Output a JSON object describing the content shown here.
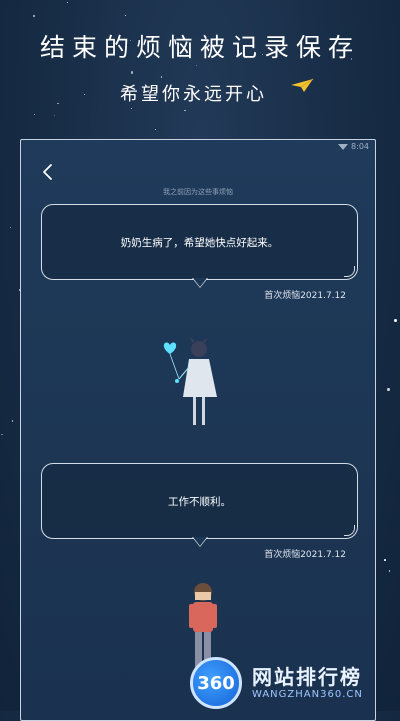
{
  "promo": {
    "headline": "结束的烦恼被记录保存",
    "subheadline": "希望你永远开心"
  },
  "screen": {
    "status_time": "8:04",
    "section_caption": "我之前因为这些事烦恼",
    "entries": [
      {
        "text": "奶奶生病了，希望她快点好起来。",
        "date": "首次烦恼2021.7.12"
      },
      {
        "text": "工作不顺利。",
        "date": "首次烦恼2021.7.12"
      }
    ]
  },
  "watermark": {
    "logo_text": "360",
    "title": "网站排行榜",
    "url": "WANGZHAN360.CN"
  },
  "colors": {
    "background": "#172c45",
    "bubble_border": "#d5dde6",
    "accent_plane": "#f2c230",
    "watermark_blue": "#1563d6"
  }
}
